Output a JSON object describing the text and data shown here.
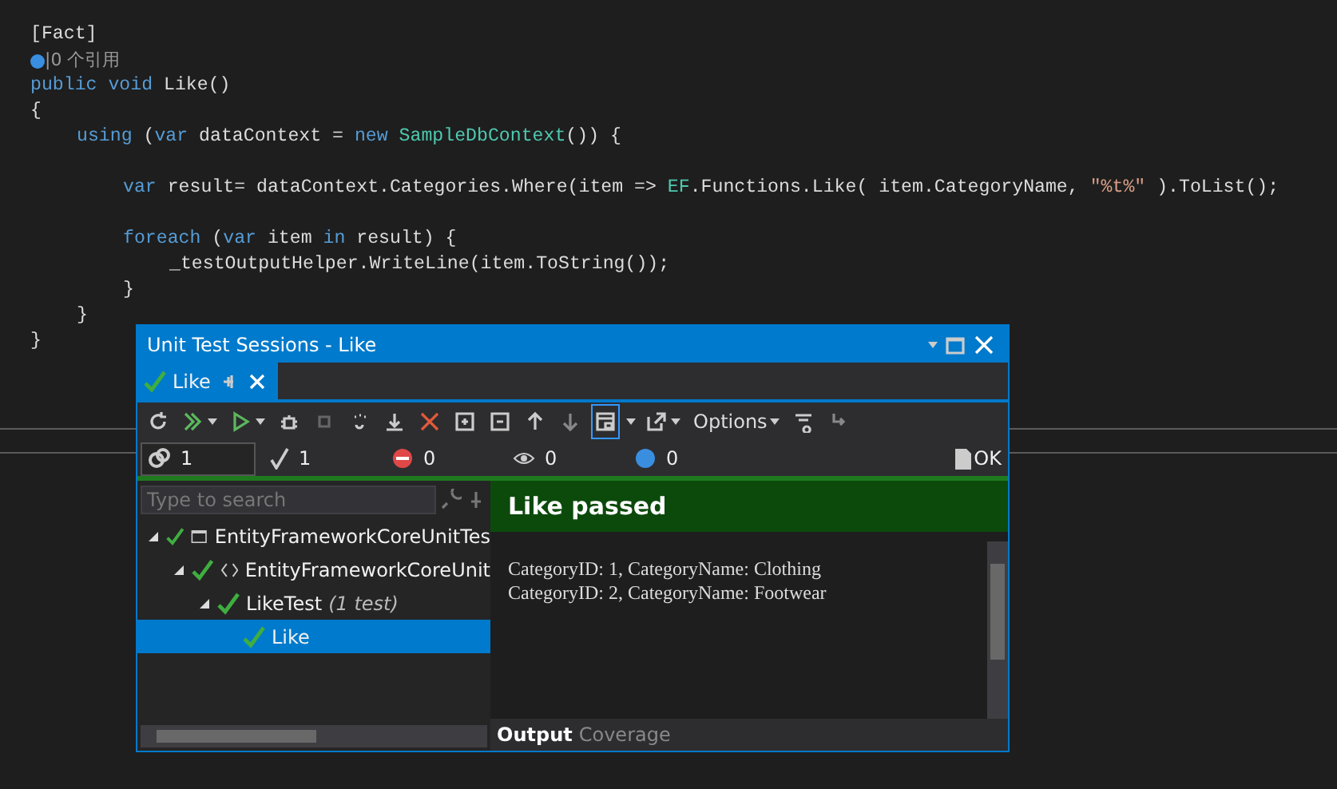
{
  "editor": {
    "lines": [
      {
        "kind": "code",
        "tokens": [
          {
            "kind": "plain",
            "text": "[Fact]"
          }
        ]
      },
      {
        "kind": "code",
        "tokens": [
          {
            "kind": "codelens",
            "text": "|0 个引用"
          }
        ]
      },
      {
        "kind": "code",
        "tokens": [
          {
            "kind": "keyword",
            "text": "public"
          },
          {
            "kind": "keyword",
            "text": " void"
          },
          {
            "kind": "plain",
            "text": " Like()"
          }
        ]
      },
      {
        "kind": "code",
        "tokens": [
          {
            "kind": "plain",
            "text": "{"
          }
        ],
        "children": [
          {
            "kind": "code",
            "tokens": [
              {
                "kind": "keyword",
                "text": "using"
              },
              {
                "kind": "plain",
                "text": " ("
              },
              {
                "kind": "keyword",
                "text": "var"
              },
              {
                "kind": "plain",
                "text": " dataContext ="
              },
              {
                "kind": "keyword",
                "text": " new"
              },
              {
                "kind": "type",
                "text": " SampleDbContext"
              },
              {
                "kind": "plain",
                "text": "()) {"
              }
            ],
            "children": [
              {
                "kind": "blank"
              },
              {
                "kind": "code",
                "tokens": [
                  {
                    "kind": "keyword",
                    "text": "var"
                  },
                  {
                    "kind": "plain",
                    "text": " result= dataContext.Categories.Where(item =>"
                  },
                  {
                    "kind": "type",
                    "text": " EF"
                  },
                  {
                    "kind": "plain",
                    "text": ".Functions.Like( item.CategoryName,"
                  },
                  {
                    "kind": "string",
                    "text": " \"%t%\""
                  },
                  {
                    "kind": "plain",
                    "text": " ).ToList();"
                  }
                ]
              },
              {
                "kind": "blank"
              },
              {
                "kind": "code",
                "tokens": [
                  {
                    "kind": "keyword",
                    "text": "foreach"
                  },
                  {
                    "kind": "plain",
                    "text": " ("
                  },
                  {
                    "kind": "keyword",
                    "text": "var"
                  },
                  {
                    "kind": "plain",
                    "text": " item"
                  },
                  {
                    "kind": "keyword",
                    "text": " in"
                  },
                  {
                    "kind": "plain",
                    "text": " result) {"
                  }
                ],
                "children": [
                  {
                    "kind": "code",
                    "tokens": [
                      {
                        "kind": "plain",
                        "text": "_testOutputHelper.WriteLine(item.ToString());"
                      }
                    ]
                  }
                ]
              },
              {
                "kind": "code",
                "tokens": [
                  {
                    "kind": "plain",
                    "text": "}"
                  }
                ]
              }
            ]
          },
          {
            "kind": "code",
            "tokens": [
              {
                "kind": "plain",
                "text": "}"
              }
            ]
          }
        ]
      },
      {
        "kind": "code",
        "tokens": [
          {
            "kind": "plain",
            "text": "}"
          }
        ]
      }
    ]
  },
  "panel": {
    "title": "Unit Test Sessions - Like",
    "tabs": [
      {
        "label": "Like",
        "selected": true
      }
    ],
    "toolbar": {
      "options_label": "Options",
      "layout_pressed": true
    },
    "counters": [
      {
        "kind": "total",
        "value": "1",
        "selected": true
      },
      {
        "kind": "passed",
        "value": "1",
        "selected": false
      },
      {
        "kind": "failed",
        "value": "0",
        "selected": false
      },
      {
        "kind": "ignored",
        "value": "0",
        "selected": false
      },
      {
        "kind": "unknown",
        "value": "0",
        "selected": false
      }
    ],
    "status": "OK",
    "search": {
      "placeholder": "Type to search"
    },
    "tree": [
      {
        "kind": "project",
        "label": "EntityFrameworkCoreUnitTes",
        "expanded": true,
        "selected": false,
        "children": [
          {
            "kind": "namespace",
            "label": "EntityFrameworkCoreUnit",
            "expanded": true,
            "selected": false,
            "children": [
              {
                "label": "LikeTest",
                "count": "(1 test)",
                "expanded": true,
                "selected": false,
                "children": [
                  {
                    "label": "Like",
                    "selected": true
                  }
                ]
              }
            ]
          }
        ]
      }
    ],
    "result": {
      "title": "Like passed",
      "output": [
        "CategoryID: 1, CategoryName: Clothing",
        "CategoryID: 2, CategoryName: Footwear"
      ]
    },
    "bottom_tabs": [
      {
        "label": "Output",
        "selected": true
      },
      {
        "label": "Coverage",
        "selected": false
      }
    ]
  }
}
